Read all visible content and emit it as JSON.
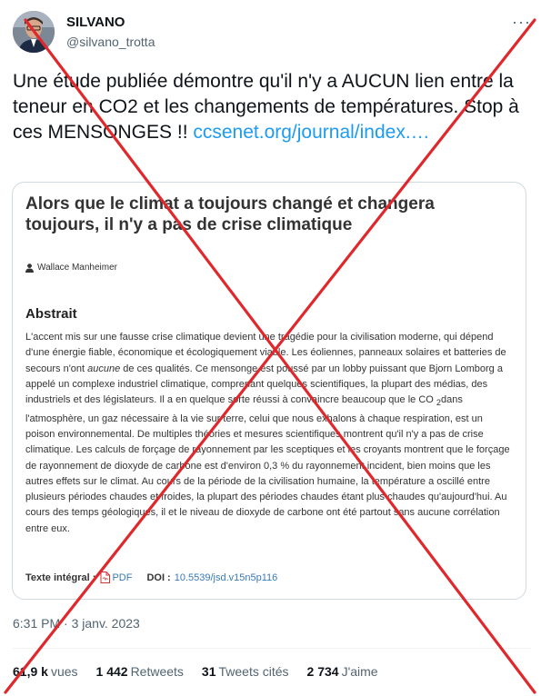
{
  "user": {
    "name": "SILVANO",
    "handle": "@silvano_trotta"
  },
  "tweet": {
    "text": "Une étude publiée démontre qu'il n'y a AUCUN lien entre la teneur en CO2 et les changements de températures. Stop à ces MENSONGES !! ",
    "link": "ccsenet.org/journal/index.…"
  },
  "article": {
    "title": "Alors que le climat a toujours changé et changera toujours, il n'y a pas de crise climatique",
    "author": "Wallace Manheimer",
    "abstract_heading": "Abstrait",
    "abstract_part1": "L'accent mis sur une fausse crise climatique devient une tragédie pour la civilisation moderne, qui dépend d'une énergie fiable, économique et écologiquement viable. Les éoliennes, panneaux solaires et batteries de secours n'ont ",
    "abstract_italic": "aucune",
    "abstract_part2": " de ces qualités. Ce mensonge est poussé par un lobby puissant que Bjorn Lomborg a appelé un complexe industriel climatique, comprenant quelques scientifiques, la plupart des médias, des industriels et des législateurs. Il a en quelque sorte réussi à convaincre beaucoup que le CO ",
    "abstract_sub": "2",
    "abstract_part3": "dans l'atmosphère, un gaz nécessaire à la vie sur terre, celui que nous exhalons à chaque respiration, est un poison environnemental. De multiples théories et mesures scientifiques montrent qu'il n'y a pas de crise climatique. Les calculs de forçage de rayonnement par les sceptiques et les croyants montrent que le forçage de rayonnement de dioxyde de carbone est d'environ 0,3 % du rayonnement incident, bien moins que les autres effets sur le climat. Au cours de la période de la civilisation humaine, la température a oscillé entre plusieurs périodes chaudes et froides, la plupart des périodes chaudes étant plus chaudes qu'aujourd'hui. Au cours des temps géologiques, il et le niveau de dioxyde de carbone ont été partout sans aucune corrélation entre eux.",
    "fulltext_label": "Texte intégral :",
    "pdf_label": "PDF",
    "doi_label": "DOI :",
    "doi_value": "10.5539/jsd.v15n5p116"
  },
  "timestamp": "6:31 PM · 3 janv. 2023",
  "stats": {
    "views_count": "61,9 k",
    "views_label": "vues",
    "retweets_count": "1 442",
    "retweets_label": "Retweets",
    "quotes_count": "31",
    "quotes_label": "Tweets cités",
    "likes_count": "2 734",
    "likes_label": "J'aime"
  },
  "colors": {
    "link": "#1d9bf0",
    "cross": "#e0282c",
    "muted": "#536471"
  },
  "icons": [
    "avatar",
    "more-icon",
    "user-icon",
    "pdf-icon"
  ]
}
